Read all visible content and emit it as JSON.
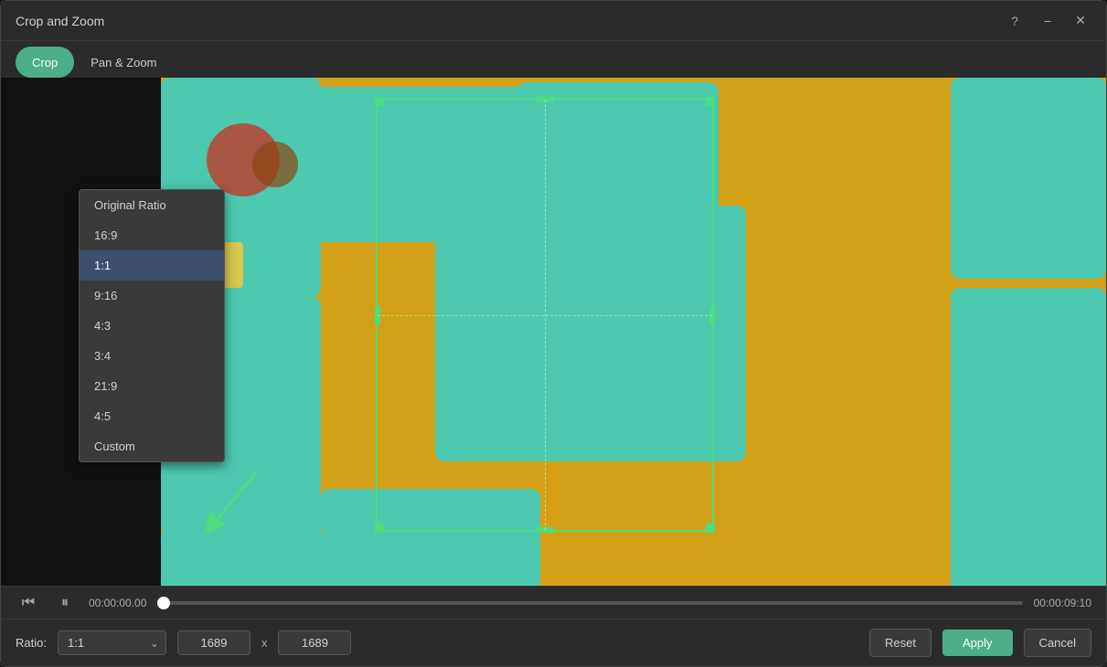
{
  "dialog": {
    "title": "Crop and Zoom",
    "tabs": [
      {
        "id": "crop",
        "label": "Crop",
        "active": true
      },
      {
        "id": "pan-zoom",
        "label": "Pan & Zoom",
        "active": false
      }
    ]
  },
  "controls": {
    "help_icon": "?",
    "minimize_icon": "−",
    "close_icon": "✕"
  },
  "dropdown": {
    "items": [
      {
        "id": "original",
        "label": "Original Ratio",
        "selected": false
      },
      {
        "id": "16-9",
        "label": "16:9",
        "selected": false
      },
      {
        "id": "1-1",
        "label": "1:1",
        "selected": true
      },
      {
        "id": "9-16",
        "label": "9:16",
        "selected": false
      },
      {
        "id": "4-3",
        "label": "4:3",
        "selected": false
      },
      {
        "id": "3-4",
        "label": "3:4",
        "selected": false
      },
      {
        "id": "21-9",
        "label": "21:9",
        "selected": false
      },
      {
        "id": "4-5",
        "label": "4:5",
        "selected": false
      },
      {
        "id": "custom",
        "label": "Custom",
        "selected": false
      }
    ]
  },
  "ratio_controls": {
    "ratio_label": "Ratio:",
    "ratio_value": "1:1",
    "width_value": "1689",
    "height_value": "1689",
    "separator": "x"
  },
  "timeline": {
    "current_time": "00:00:00.00",
    "end_time": "00:00:09:10"
  },
  "buttons": {
    "reset_label": "Reset",
    "apply_label": "Apply",
    "cancel_label": "Cancel"
  }
}
